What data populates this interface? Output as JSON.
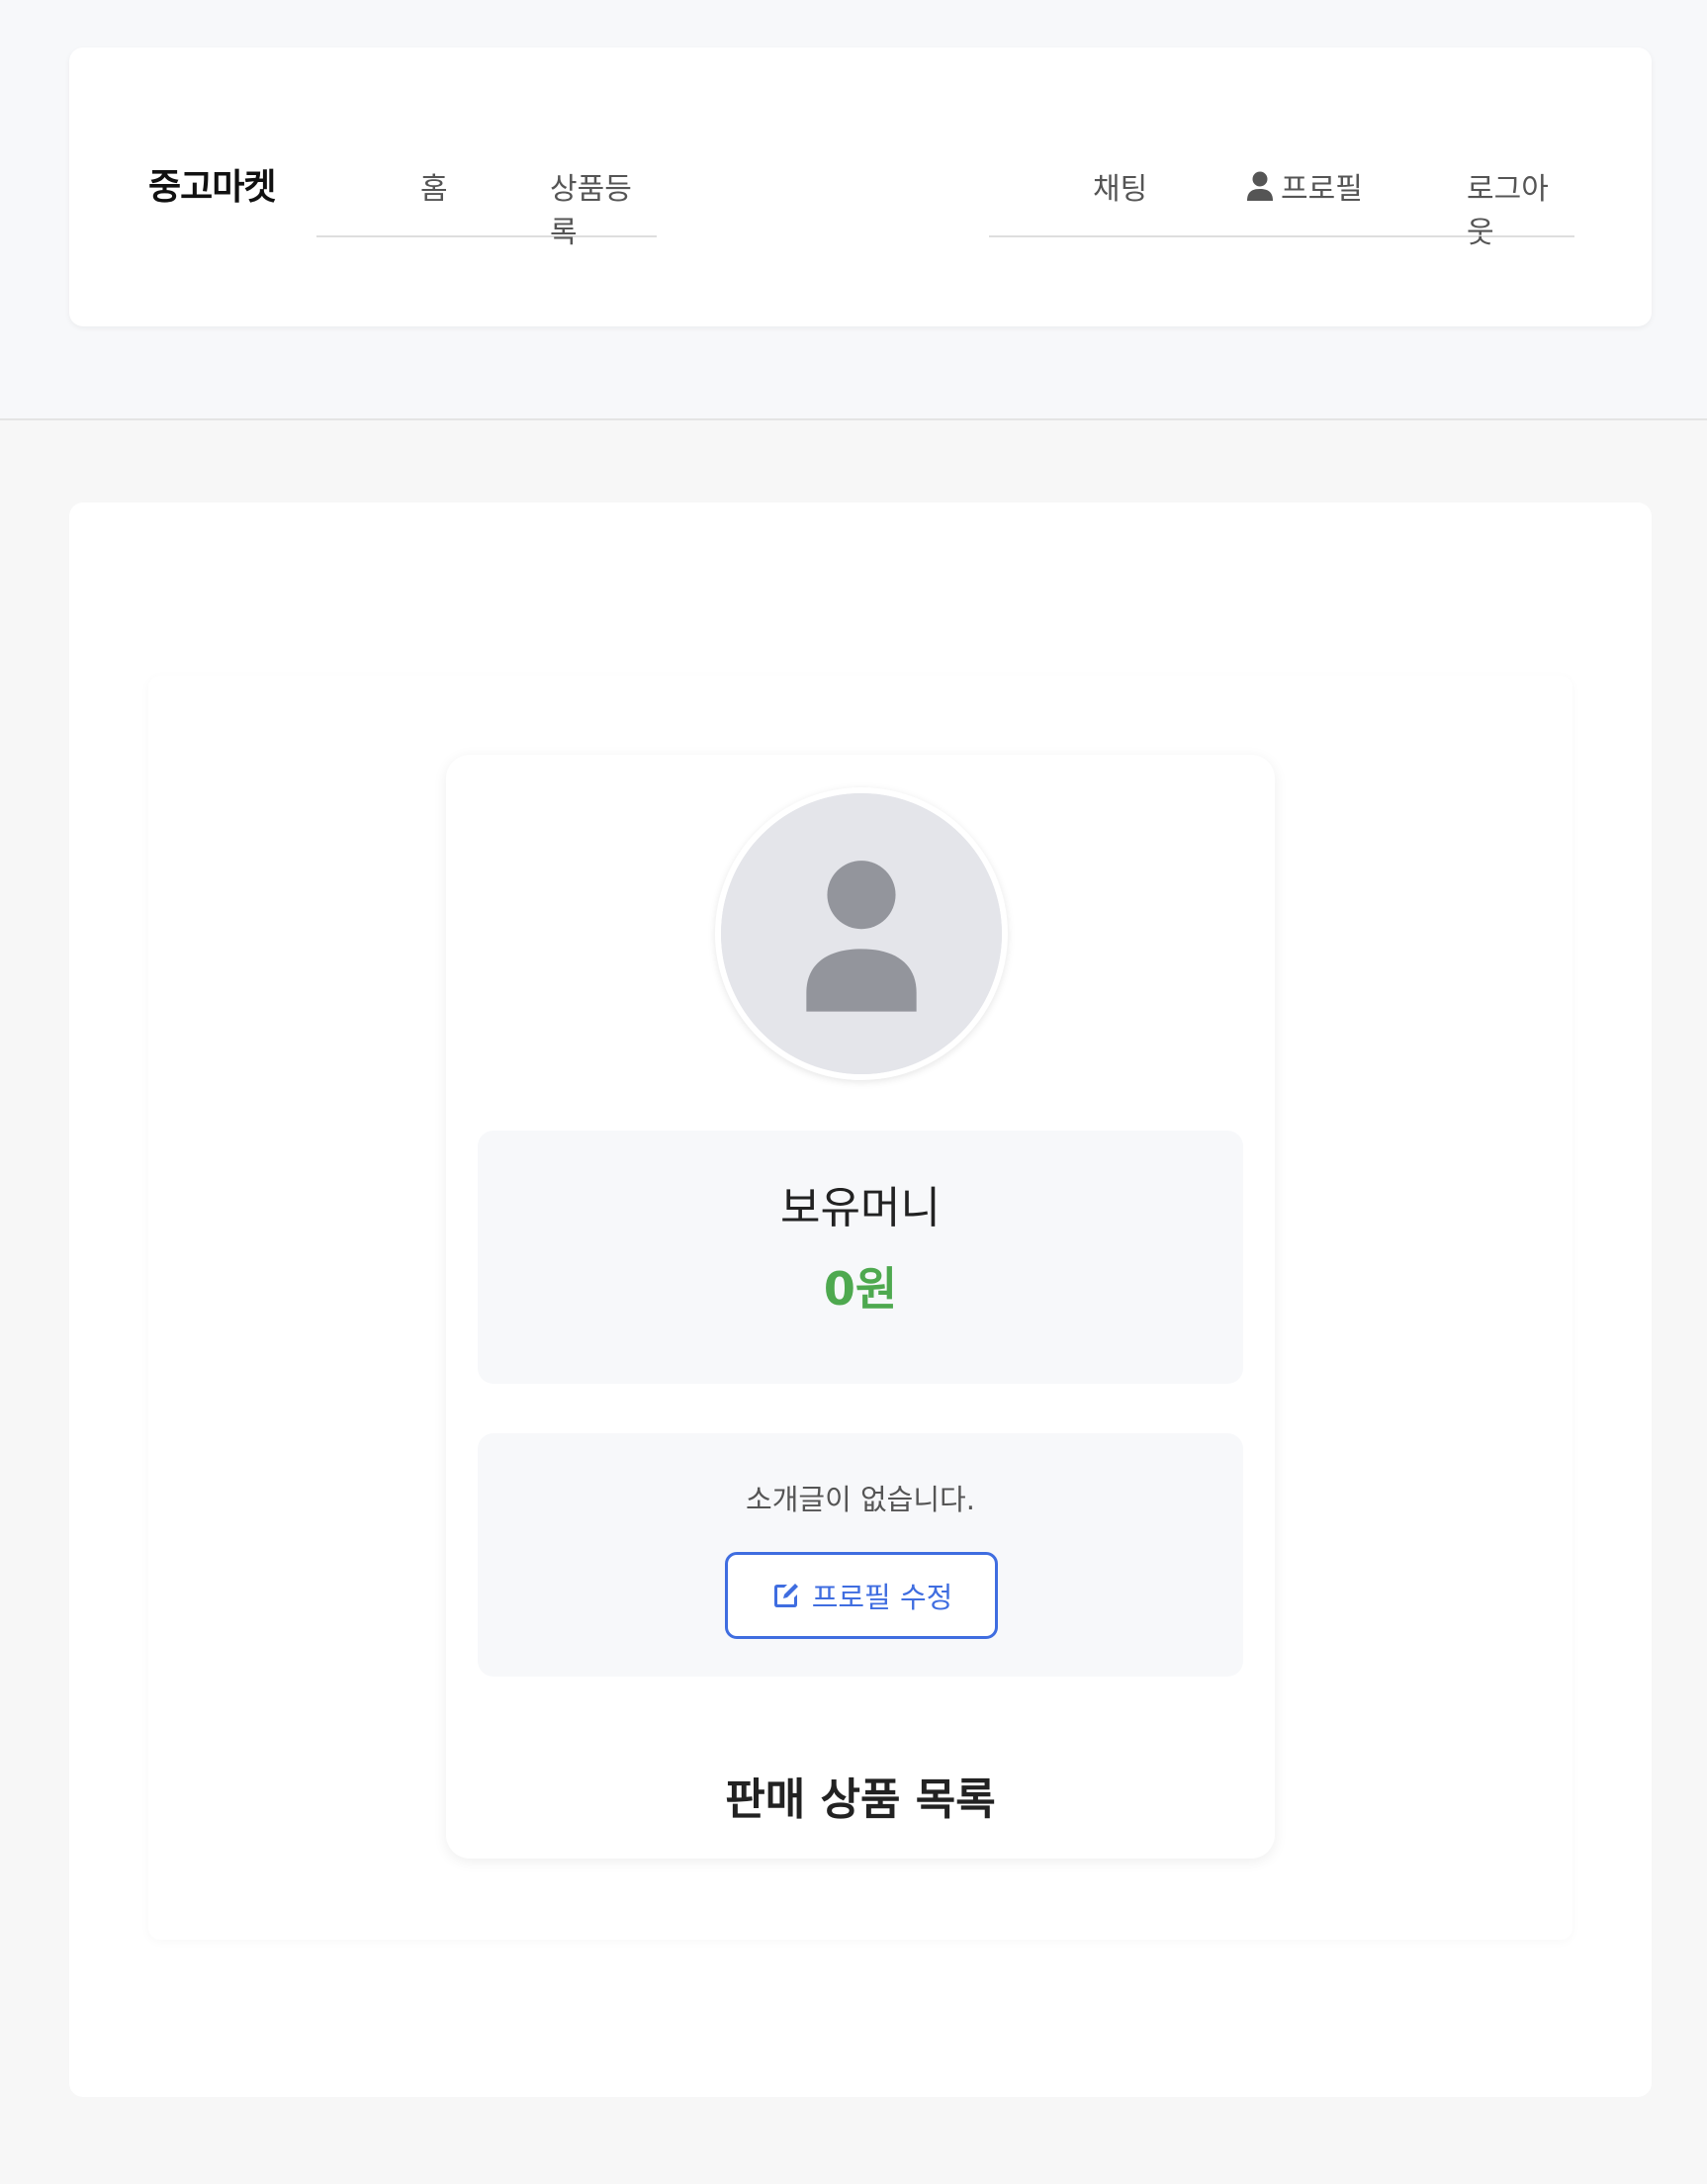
{
  "header": {
    "brand": "중고마켓",
    "nav_left": [
      {
        "label": "홈"
      },
      {
        "label": "상품등록"
      }
    ],
    "nav_right": [
      {
        "label": "채팅"
      },
      {
        "label": "프로필",
        "icon": "user-icon"
      },
      {
        "label": "로그아웃"
      }
    ]
  },
  "profile": {
    "avatar_icon": "default-user-avatar-icon",
    "money_label": "보유머니",
    "money_value": "0원",
    "intro_text": "소개글이 없습니다.",
    "edit_button_label": "프로필 수정",
    "edit_button_icon": "edit-icon",
    "products_section_title": "판매 상품 목록"
  },
  "colors": {
    "accent_blue": "#3f6de0",
    "money_green": "#4ea94f",
    "avatar_bg": "#e4e5ea",
    "avatar_fg": "#93959c"
  }
}
